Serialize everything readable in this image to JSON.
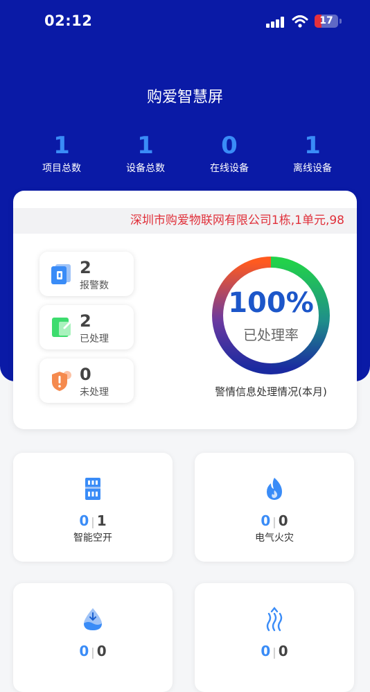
{
  "status_bar": {
    "time": "02:12",
    "battery": "17"
  },
  "app": {
    "title": "购爱智慧屏"
  },
  "stats": [
    {
      "value": "1",
      "label": "项目总数"
    },
    {
      "value": "1",
      "label": "设备总数"
    },
    {
      "value": "0",
      "label": "在线设备"
    },
    {
      "value": "1",
      "label": "离线设备"
    }
  ],
  "marquee": {
    "text": "深圳市购爱物联网有限公司1栋,1单元,98"
  },
  "alarm_summary": [
    {
      "value": "2",
      "label": "报警数",
      "icon": "document-icon"
    },
    {
      "value": "2",
      "label": "已处理",
      "icon": "notepad-check-icon"
    },
    {
      "value": "0",
      "label": "未处理",
      "icon": "shield-alert-icon"
    }
  ],
  "processing_rate": {
    "percent_text": "100%",
    "percent": 100,
    "sublabel": "已处理率",
    "caption": "警情信息处理情况(本月)"
  },
  "device_tiles": [
    {
      "name": "智能空开",
      "a": "0",
      "b": "1",
      "icon": "circuit-breaker-icon"
    },
    {
      "name": "电气火灾",
      "a": "0",
      "b": "0",
      "icon": "flame-icon"
    },
    {
      "name": "",
      "a": "0",
      "b": "0",
      "icon": "water-drop-icon"
    },
    {
      "name": "",
      "a": "0",
      "b": "0",
      "icon": "heat-waves-icon"
    }
  ],
  "colors": {
    "header_bg": "#0a1aa6",
    "accent_blue": "#3a8cf7",
    "alert_red": "#e0303a",
    "donut_green": "#22d14a",
    "donut_orange": "#ff5a1f",
    "donut_navy": "#1a2aa0"
  }
}
